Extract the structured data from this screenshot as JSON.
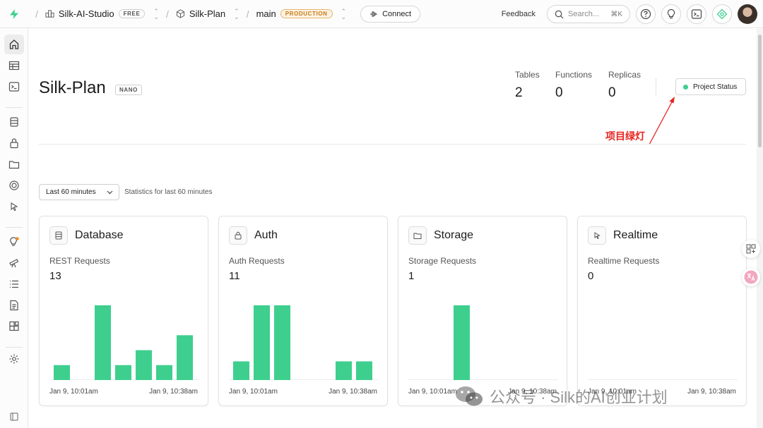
{
  "topbar": {
    "org_name": "Silk-AI-Studio",
    "org_plan": "FREE",
    "project_name": "Silk-Plan",
    "branch_name": "main",
    "branch_env": "PRODUCTION",
    "connect_label": "Connect",
    "feedback_label": "Feedback",
    "search_placeholder": "Search...",
    "search_shortcut": "⌘K"
  },
  "sidebar": {
    "items": [
      "home-icon",
      "table-editor-icon",
      "sql-editor-icon",
      "database-icon",
      "auth-icon",
      "storage-icon",
      "edge-functions-icon",
      "realtime-icon",
      "advisors-icon",
      "reports-icon",
      "logs-icon",
      "api-docs-icon",
      "integrations-icon",
      "settings-icon",
      "collapse-icon"
    ]
  },
  "header": {
    "project_title": "Silk-Plan",
    "compute_size": "NANO",
    "stats": [
      {
        "label": "Tables",
        "value": "2"
      },
      {
        "label": "Functions",
        "value": "0"
      },
      {
        "label": "Replicas",
        "value": "0"
      }
    ],
    "status_button": "Project Status",
    "status_color": "#3ecf8e",
    "annotation": "项目绿灯",
    "annotation_color": "#e8231f"
  },
  "filter": {
    "range_label": "Last 60 minutes",
    "note": "Statistics for last 60 minutes"
  },
  "cards": [
    {
      "title": "Database",
      "icon": "database-icon",
      "metric": "REST Requests",
      "total": "13",
      "axis_start": "Jan 9, 10:01am",
      "axis_end": "Jan 9, 10:38am"
    },
    {
      "title": "Auth",
      "icon": "auth-icon",
      "metric": "Auth Requests",
      "total": "11",
      "axis_start": "Jan 9, 10:01am",
      "axis_end": "Jan 9, 10:38am"
    },
    {
      "title": "Storage",
      "icon": "storage-icon",
      "metric": "Storage Requests",
      "total": "1",
      "axis_start": "Jan 9, 10:01am",
      "axis_end": "Jan 9, 10:38am"
    },
    {
      "title": "Realtime",
      "icon": "realtime-icon",
      "metric": "Realtime Requests",
      "total": "0",
      "axis_start": "Jan 9, 10:01am",
      "axis_end": "Jan 9, 10:38am"
    }
  ],
  "chart_data": [
    {
      "type": "bar",
      "series": [
        {
          "values": [
            1,
            0,
            5,
            1,
            2,
            1,
            3
          ]
        }
      ],
      "ylim": [
        0,
        5
      ],
      "xlabel": "",
      "ylabel": "",
      "bar_color": "#3ecf8e"
    },
    {
      "type": "bar",
      "series": [
        {
          "values": [
            1,
            4,
            4,
            0,
            0,
            1,
            1
          ]
        }
      ],
      "ylim": [
        0,
        4
      ],
      "xlabel": "",
      "ylabel": "",
      "bar_color": "#3ecf8e"
    },
    {
      "type": "bar",
      "series": [
        {
          "values": [
            0,
            0,
            1,
            0,
            0,
            0,
            0
          ]
        }
      ],
      "ylim": [
        0,
        1
      ],
      "xlabel": "",
      "ylabel": "",
      "bar_color": "#3ecf8e"
    },
    {
      "type": "bar",
      "series": [
        {
          "values": [
            0,
            0,
            0,
            0,
            0,
            0,
            0
          ]
        }
      ],
      "ylim": [
        0,
        1
      ],
      "xlabel": "",
      "ylabel": "",
      "bar_color": "#3ecf8e"
    }
  ],
  "watermark": {
    "text": "公众号 · Silk的AI创业计划"
  }
}
